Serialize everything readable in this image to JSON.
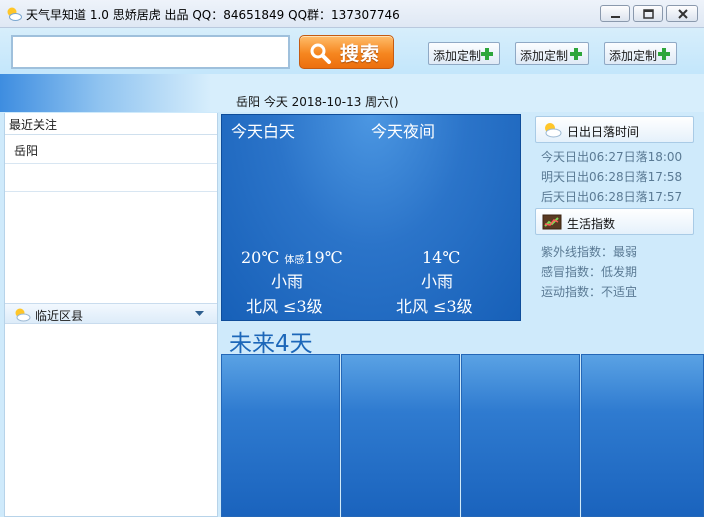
{
  "window": {
    "title": "天气早知道 1.0   思娇居虎 出品 QQ：84651849 QQ群：137307746"
  },
  "toolbar": {
    "search_value": "",
    "search_button": "搜索",
    "add_buttons": [
      "添加定制",
      "添加定制",
      "添加定制"
    ]
  },
  "banner": {
    "date_line": "岳阳 今天 2018-10-13 周六()"
  },
  "left_panel": {
    "recent_header": "最近关注",
    "recent_items": [
      "岳阳"
    ],
    "nearby_header": "临近区县"
  },
  "today": {
    "day_heading": "今天白天",
    "night_heading": "今天夜间",
    "day_temp": "20℃",
    "feels_like_label": "体感",
    "feels_like_temp": "19℃",
    "day_weather": "小雨",
    "day_wind": "北风 ≤3级",
    "night_temp": "14℃",
    "night_weather": "小雨",
    "night_wind": "北风 ≤3级"
  },
  "future": {
    "label": "未来4天"
  },
  "sun": {
    "header": "日出日落时间",
    "lines": [
      "今天日出06:27日落18:00",
      "明天日出06:28日落17:58",
      "后天日出06:28日落17:57"
    ]
  },
  "life": {
    "header": "生活指数",
    "lines": [
      "紫外线指数：最弱",
      "感冒指数：低发期",
      "运动指数：不适宜"
    ]
  },
  "colors": {
    "panel_blue": "#1760b8",
    "accent_orange": "#f6861f",
    "plus_green": "#2da63a",
    "future_text": "#1c67b9"
  },
  "icons": {
    "app": "weather-icon",
    "search": "magnifier-icon",
    "add": "plus-icon",
    "sun_section": "partly-cloudy-icon",
    "life_section": "chart-icon",
    "nearby": "partly-cloudy-icon"
  }
}
